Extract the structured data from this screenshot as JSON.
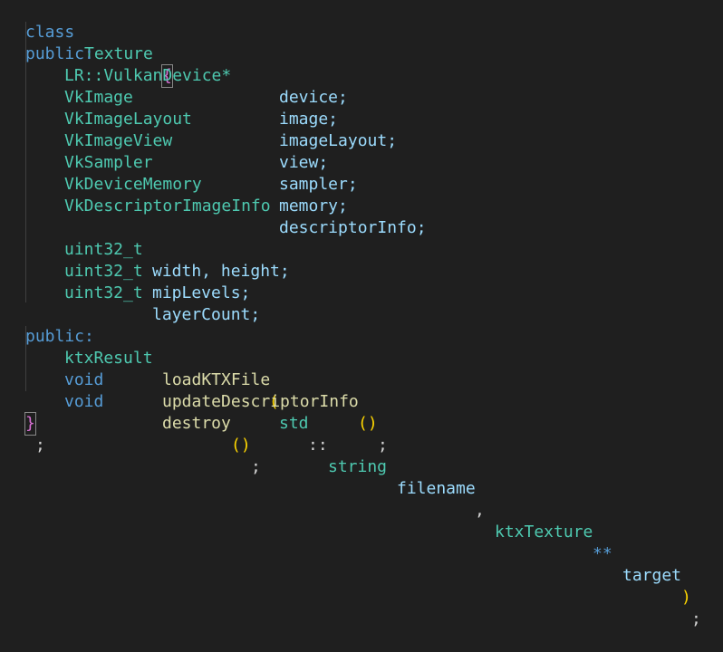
{
  "code": {
    "class_kw": "class",
    "class_name": "Texture",
    "open_brace": "{",
    "public_kw": "public:",
    "members": [
      {
        "type": "LR::VulkanDevice*",
        "name": "device;"
      },
      {
        "type": "VkImage",
        "name": "image;"
      },
      {
        "type": "VkImageLayout",
        "name": "imageLayout;"
      },
      {
        "type": "VkImageView",
        "name": "view;"
      },
      {
        "type": "VkSampler",
        "name": "sampler;"
      },
      {
        "type": "VkDeviceMemory",
        "name": "memory;"
      },
      {
        "type": "VkDescriptorImageInfo",
        "name": "descriptorInfo;"
      }
    ],
    "uint_members": [
      {
        "type": "uint32_t",
        "names": "width, height;"
      },
      {
        "type": "uint32_t",
        "names": "mipLevels;"
      },
      {
        "type": "uint32_t",
        "names": "layerCount;"
      }
    ],
    "public_kw2": "public:",
    "methods": {
      "load_ret": "ktxResult",
      "load_name": "loadKTXFile",
      "load_p1_ns": "std",
      "load_p1_sep": "::",
      "load_p1_type": "string",
      "load_p1_name": "filename",
      "load_p2_type": "ktxTexture",
      "load_p2_ptr": "**",
      "load_p2_name": "target",
      "update_ret": "void",
      "update_name": "updateDescriptorInfo",
      "destroy_ret": "void",
      "destroy_name": "destroy"
    },
    "close_brace": "}",
    "close_semi": ";"
  },
  "colors": {
    "background": "#1f1f1f",
    "keyword": "#569cd6",
    "type": "#4ec9b0",
    "identifier": "#9cdcfe",
    "function": "#dcdcaa"
  }
}
